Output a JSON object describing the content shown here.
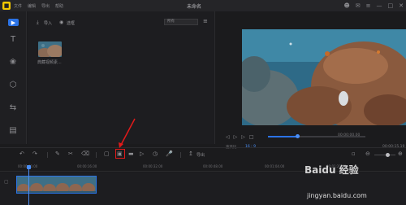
{
  "window": {
    "title": "未命名",
    "menus": [
      "文件",
      "编辑",
      "导出",
      "帮助"
    ]
  },
  "media_panel": {
    "import_label": "导入",
    "sort_label": "选框",
    "filter_value": "所有",
    "items": [
      {
        "label": "典藏视频素..."
      }
    ]
  },
  "preview": {
    "aspect_label": "宽高比",
    "aspect_value": "16 : 9",
    "time_current": "00:00:00.00",
    "time_total": "00:00:15.19",
    "playback_progress": 0.3
  },
  "toolbar": {
    "export_label": "导出"
  },
  "timeline": {
    "ticks": [
      "00:00:00.00",
      "00:00:16.00",
      "00:00:32.00",
      "00:00:48.00",
      "00:01:04.00",
      "00:01:20.00"
    ]
  },
  "watermark": {
    "text": "Baidu 经验",
    "url": "jingyan.baidu.com"
  },
  "colors": {
    "accent": "#2b73e6",
    "highlight": "#e11a1a",
    "logo": "#f4c800"
  }
}
